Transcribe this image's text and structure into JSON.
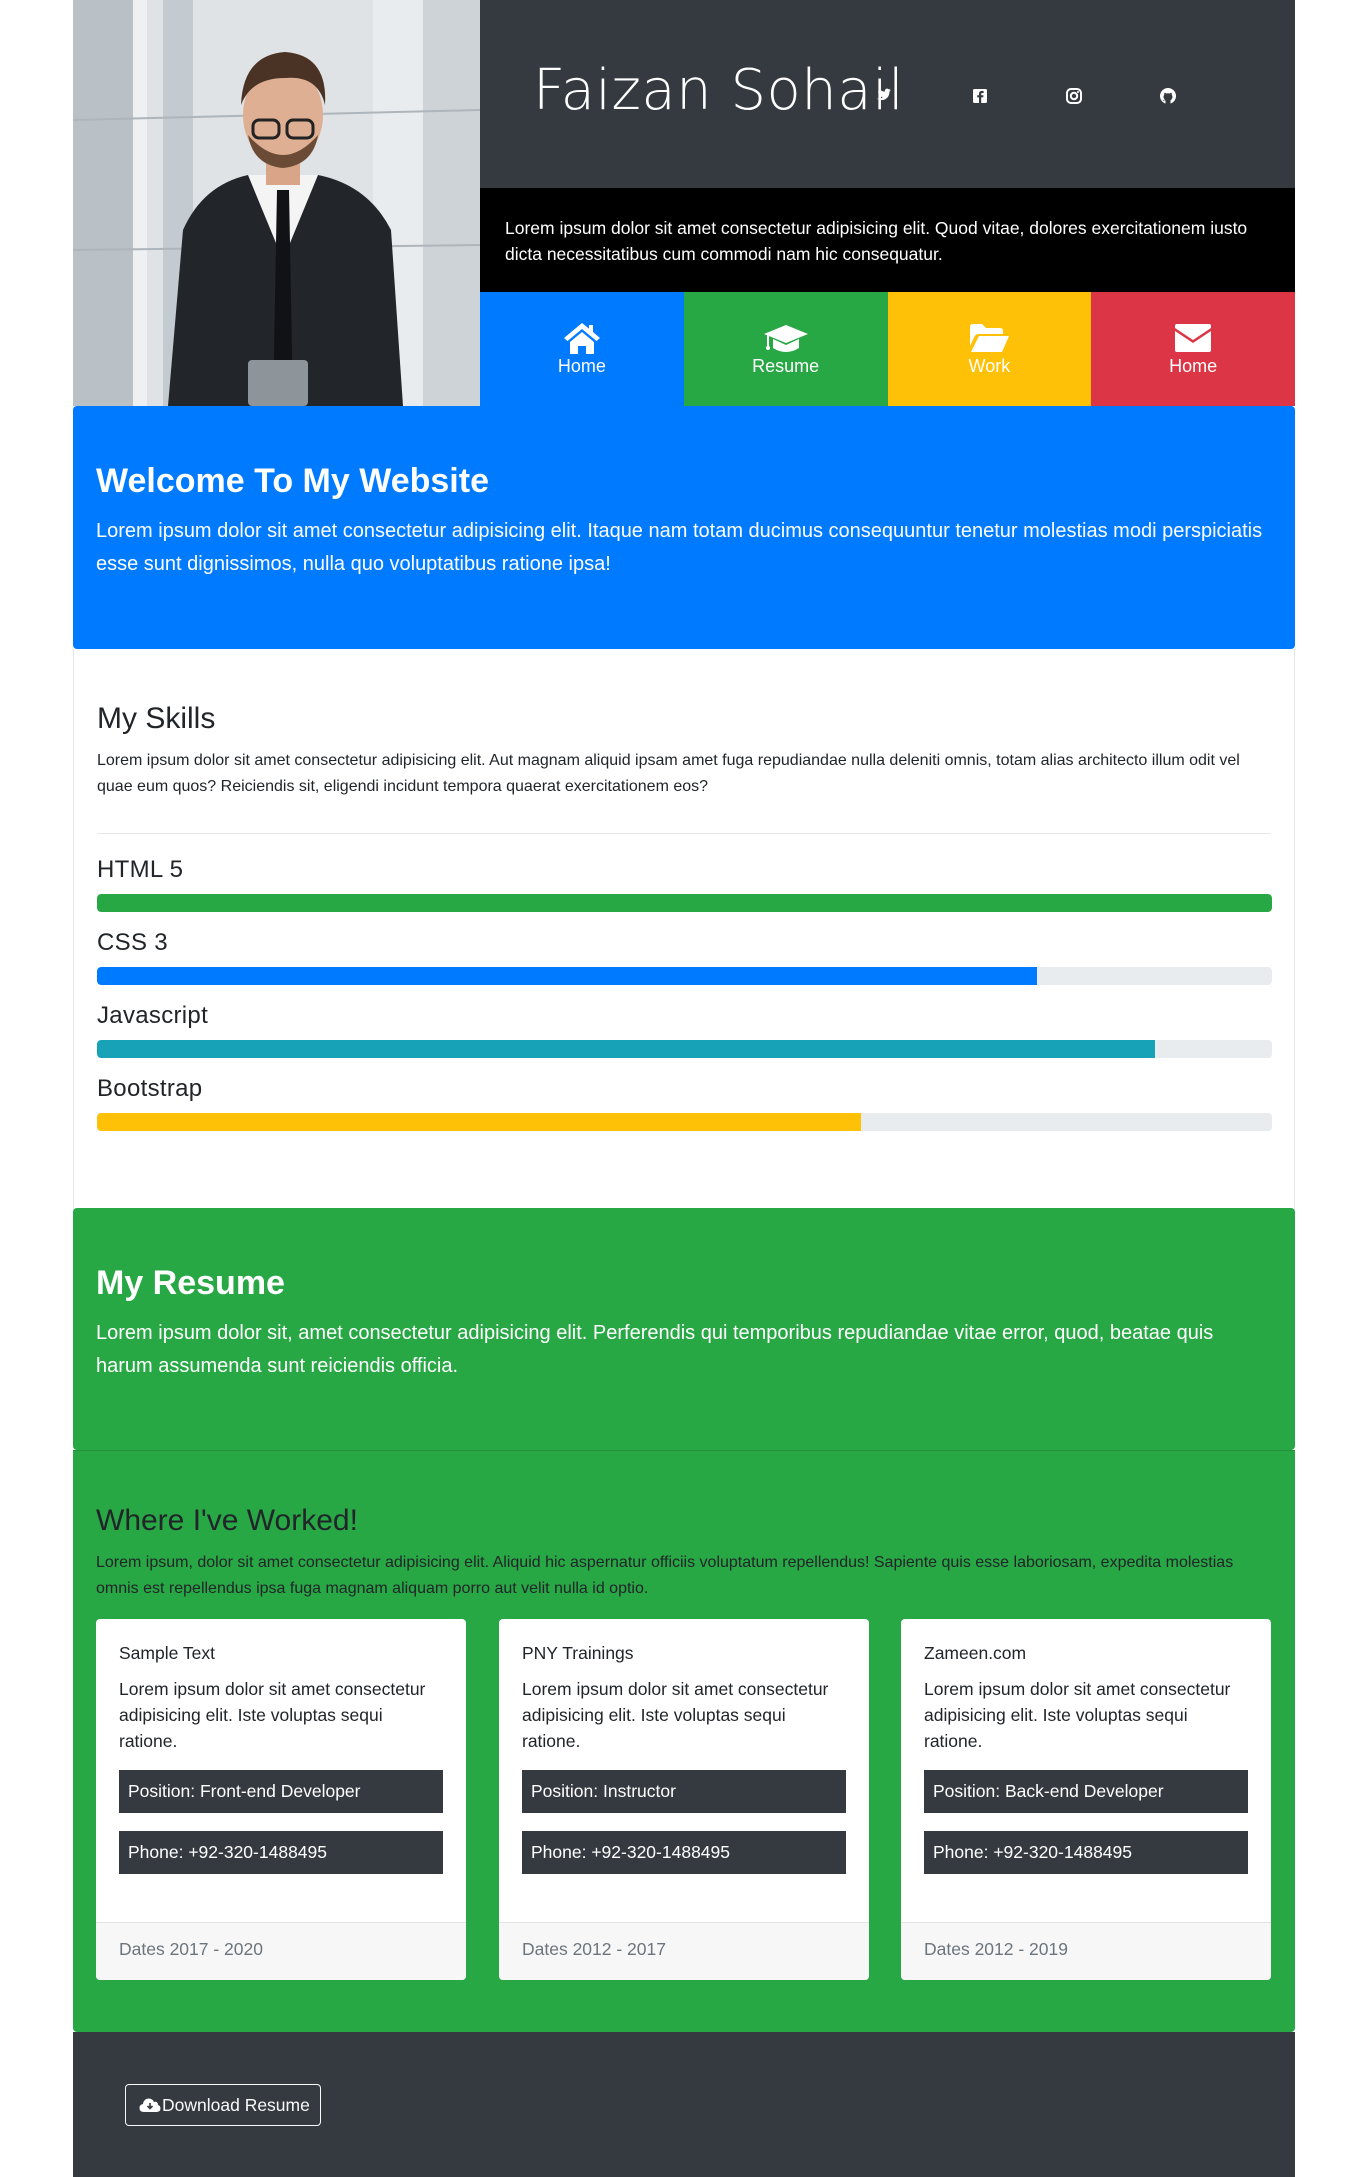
{
  "profile": {
    "name": "Faizan Sohail",
    "intro": "Lorem ipsum dolor sit amet consectetur adipisicing elit. Quod vitae, dolores exercitationem iusto dicta necessitatibus cum commodi nam hic consequatur.",
    "social": [
      "twitter-icon",
      "facebook-icon",
      "instagram-icon",
      "github-icon"
    ]
  },
  "nav": [
    {
      "label": "Home",
      "icon": "home-icon",
      "color": "#007bff"
    },
    {
      "label": "Resume",
      "icon": "graduation-cap-icon",
      "color": "#28a745"
    },
    {
      "label": "Work",
      "icon": "folder-open-icon",
      "color": "#ffc107"
    },
    {
      "label": "Home",
      "icon": "envelope-icon",
      "color": "#dc3545"
    }
  ],
  "welcome": {
    "title": "Welcome To My Website",
    "text": "Lorem ipsum dolor sit amet consectetur adipisicing elit. Itaque nam totam ducimus consequuntur tenetur molestias modi perspiciatis esse sunt dignissimos, nulla quo voluptatibus ratione ipsa!"
  },
  "skills": {
    "title": "My Skills",
    "text": "Lorem ipsum dolor sit amet consectetur adipisicing elit. Aut magnam aliquid ipsam amet fuga repudiandae nulla deleniti omnis, totam alias architecto illum odit vel quae eum quos? Reiciendis sit, eligendi incidunt tempora quaerat exercitationem eos?",
    "items": [
      {
        "label": "HTML 5",
        "percent": 100,
        "color": "#28a745"
      },
      {
        "label": "CSS 3",
        "percent": 80,
        "color": "#007bff"
      },
      {
        "label": "Javascript",
        "percent": 90,
        "color": "#17a2b8"
      },
      {
        "label": "Bootstrap",
        "percent": 65,
        "color": "#ffc107"
      }
    ]
  },
  "resume": {
    "title": "My Resume",
    "text": "Lorem ipsum dolor sit, amet consectetur adipisicing elit. Perferendis qui temporibus repudiandae vitae error, quod, beatae quis harum assumenda sunt reiciendis officia."
  },
  "work": {
    "title": "Where I've Worked!",
    "text": "Lorem ipsum, dolor sit amet consectetur adipisicing elit. Aliquid hic aspernatur officiis voluptatum repellendus! Sapiente quis esse laboriosam, expedita molestias omnis est repellendus ipsa fuga magnam aliquam porro aut velit nulla id optio.",
    "cards": [
      {
        "company": "Sample Text",
        "text": "Lorem ipsum dolor sit amet consectetur adipisicing elit. Iste voluptas sequi ratione.",
        "position": "Position: Front-end Developer",
        "phone": "Phone: +92-320-1488495",
        "dates": "Dates 2017 - 2020"
      },
      {
        "company": "PNY Trainings",
        "text": "Lorem ipsum dolor sit amet consectetur adipisicing elit. Iste voluptas sequi ratione.",
        "position": "Position: Instructor",
        "phone": "Phone: +92-320-1488495",
        "dates": "Dates 2012 - 2017"
      },
      {
        "company": "Zameen.com",
        "text": "Lorem ipsum dolor sit amet consectetur adipisicing elit. Iste voluptas sequi ratione.",
        "position": "Position: Back-end Developer",
        "phone": "Phone: +92-320-1488495",
        "dates": "Dates 2012 - 2019"
      }
    ]
  },
  "footer": {
    "download_label": "Download Resume",
    "download_icon": "cloud-download-icon"
  }
}
